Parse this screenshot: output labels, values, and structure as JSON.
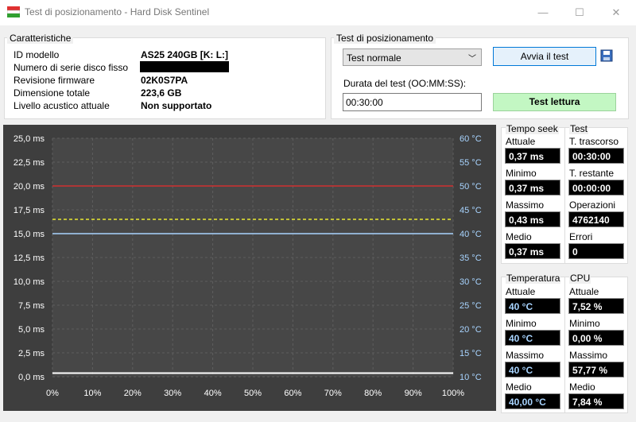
{
  "window": {
    "title": "Test di posizionamento - Hard Disk Sentinel"
  },
  "characteristics": {
    "label": "Caratteristiche",
    "rows": [
      {
        "label": "ID modello",
        "value": "AS25 240GB [K: L:]"
      },
      {
        "label": "Numero di serie disco fisso",
        "value": ""
      },
      {
        "label": "Revisione firmware",
        "value": "02K0S7PA"
      },
      {
        "label": "Dimensione totale",
        "value": "223,6 GB"
      },
      {
        "label": "Livello acustico attuale",
        "value": "Non supportato"
      }
    ]
  },
  "test": {
    "label": "Test di posizionamento",
    "mode": "Test normale",
    "start_button": "Avvia il test",
    "duration_label": "Durata del test (OO:MM:SS):",
    "duration": "00:30:00",
    "read_test_button": "Test lettura"
  },
  "chart_data": {
    "type": "line",
    "x_ticks": [
      "0%",
      "10%",
      "20%",
      "30%",
      "40%",
      "50%",
      "60%",
      "70%",
      "80%",
      "90%",
      "100%"
    ],
    "y_left_ticks": [
      "0,0 ms",
      "2,5 ms",
      "5,0 ms",
      "7,5 ms",
      "10,0 ms",
      "12,5 ms",
      "15,0 ms",
      "17,5 ms",
      "20,0 ms",
      "22,5 ms",
      "25,0 ms"
    ],
    "y_right_ticks": [
      "10 °C",
      "15 °C",
      "20 °C",
      "25 °C",
      "30 °C",
      "35 °C",
      "40 °C",
      "45 °C",
      "50 °C",
      "55 °C",
      "60 °C"
    ],
    "ylim_left": [
      0,
      25
    ],
    "ylim_right": [
      10,
      60
    ],
    "lines": [
      {
        "axis": "left",
        "value": 20.0,
        "color": "#d03030",
        "style": "solid"
      },
      {
        "axis": "left",
        "value": 16.5,
        "color": "#e8e830",
        "style": "dashed"
      },
      {
        "axis": "right",
        "value": 40,
        "color": "#a8d4ff",
        "style": "solid"
      },
      {
        "axis": "left",
        "value": 0.37,
        "color": "#ffffff",
        "style": "solid"
      }
    ],
    "grid": true
  },
  "seek": {
    "title": "Tempo seek",
    "items": [
      {
        "label": "Attuale",
        "value": "0,37 ms"
      },
      {
        "label": "Minimo",
        "value": "0,37 ms"
      },
      {
        "label": "Massimo",
        "value": "0,43 ms"
      },
      {
        "label": "Medio",
        "value": "0,37 ms"
      }
    ]
  },
  "test_stats": {
    "title": "Test",
    "items": [
      {
        "label": "T. trascorso",
        "value": "00:30:00"
      },
      {
        "label": "T. restante",
        "value": "00:00:00"
      },
      {
        "label": "Operazioni",
        "value": "4762140"
      },
      {
        "label": "Errori",
        "value": "0"
      }
    ]
  },
  "temperature": {
    "title": "Temperatura",
    "items": [
      {
        "label": "Attuale",
        "value": "40 °C"
      },
      {
        "label": "Minimo",
        "value": "40 °C"
      },
      {
        "label": "Massimo",
        "value": "40 °C"
      },
      {
        "label": "Medio",
        "value": "40,00 °C"
      }
    ]
  },
  "cpu": {
    "title": "CPU",
    "items": [
      {
        "label": "Attuale",
        "value": "7,52 %"
      },
      {
        "label": "Minimo",
        "value": "0,00 %"
      },
      {
        "label": "Massimo",
        "value": "57,77 %"
      },
      {
        "label": "Medio",
        "value": "7,84 %"
      }
    ]
  }
}
